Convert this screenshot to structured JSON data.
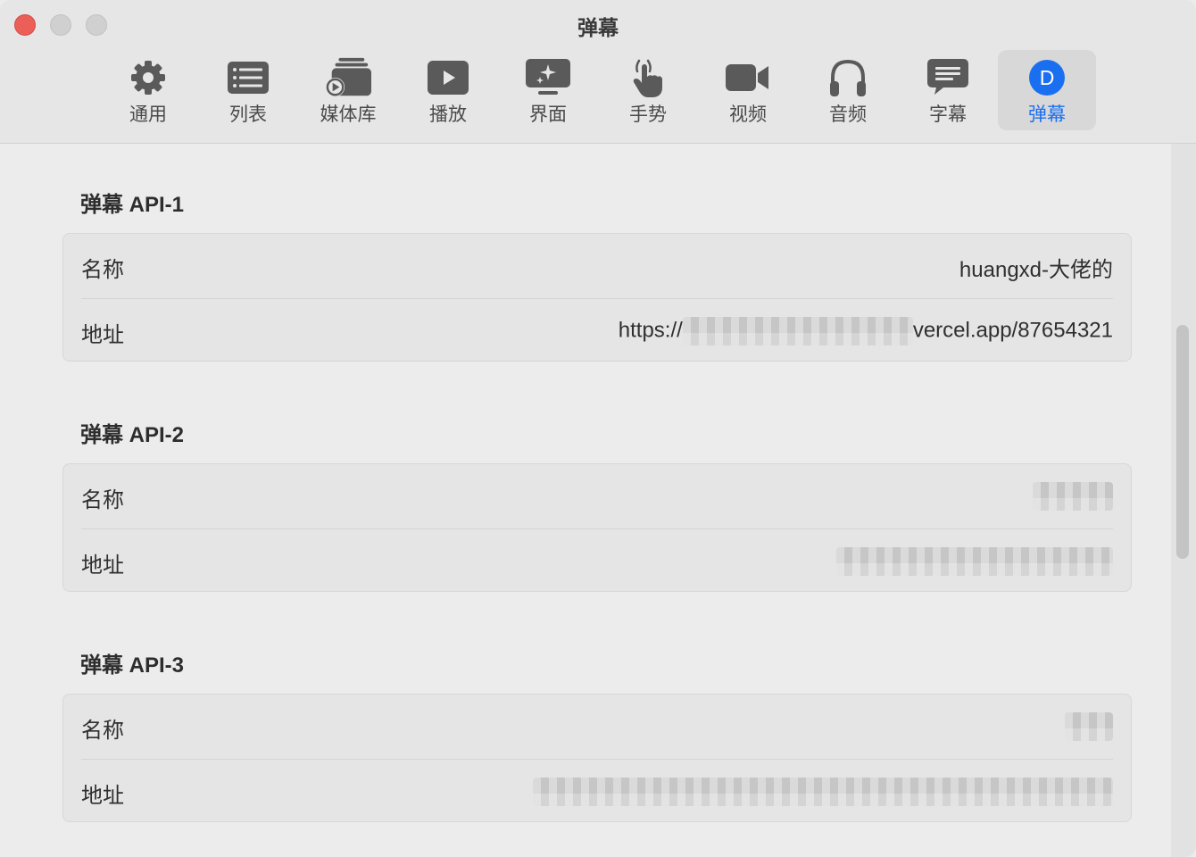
{
  "window": {
    "title": "弹幕"
  },
  "tabs": [
    {
      "label": "通用",
      "icon": "gear-icon"
    },
    {
      "label": "列表",
      "icon": "list-icon"
    },
    {
      "label": "媒体库",
      "icon": "media-library-icon"
    },
    {
      "label": "播放",
      "icon": "play-icon"
    },
    {
      "label": "界面",
      "icon": "interface-icon"
    },
    {
      "label": "手势",
      "icon": "hand-gesture-icon"
    },
    {
      "label": "视频",
      "icon": "video-camera-icon"
    },
    {
      "label": "音频",
      "icon": "headphones-icon"
    },
    {
      "label": "字幕",
      "icon": "subtitle-bubble-icon"
    },
    {
      "label": "弹幕",
      "icon": "danmaku-d-icon",
      "active": true,
      "badge": "D"
    }
  ],
  "accent_color": "#1a6ff0",
  "sections": [
    {
      "title": "弹幕 API-1",
      "name_label": "名称",
      "name_value": "huangxd-大佬的",
      "address_label": "地址",
      "address_prefix": "https://",
      "address_suffix": "vercel.app/87654321"
    },
    {
      "title": "弹幕 API-2",
      "name_label": "名称",
      "address_label": "地址"
    },
    {
      "title": "弹幕 API-3",
      "name_label": "名称",
      "address_label": "地址"
    }
  ]
}
